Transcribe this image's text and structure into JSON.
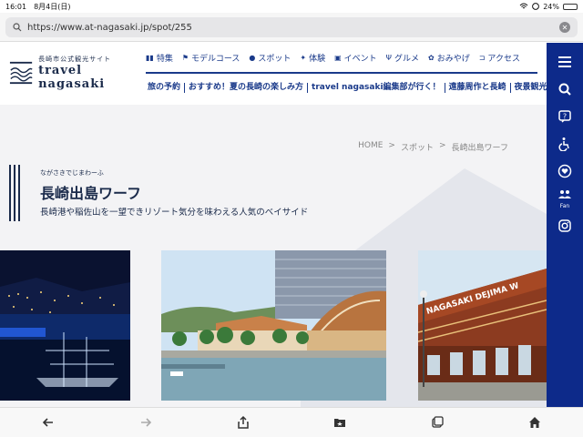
{
  "status": {
    "time": "16:01",
    "date": "8月4日(日)",
    "battery": "24%"
  },
  "browser": {
    "url": "https://www.at-nagasaki.jp/spot/255"
  },
  "logo": {
    "small": "長崎市公式観光サイト",
    "big": "travel nagasaki"
  },
  "nav_primary": [
    {
      "label": "特集",
      "icon": "book-icon"
    },
    {
      "label": "モデルコース",
      "icon": "flag-icon"
    },
    {
      "label": "スポット",
      "icon": "pin-icon"
    },
    {
      "label": "体験",
      "icon": "star-icon"
    },
    {
      "label": "イベント",
      "icon": "calendar-icon"
    },
    {
      "label": "グルメ",
      "icon": "fork-icon"
    },
    {
      "label": "おみやげ",
      "icon": "gift-icon"
    },
    {
      "label": "アクセス",
      "icon": "bus-icon"
    }
  ],
  "nav_secondary": [
    {
      "label": "旅の予約"
    },
    {
      "label": "おすすめ！夏の長崎の楽しみ方"
    },
    {
      "label": "travel nagasaki編集部が行く！"
    },
    {
      "label": "遠藤周作と長崎"
    },
    {
      "label": "夜景観光"
    }
  ],
  "sidebar": {
    "fan_label": "Fan"
  },
  "breadcrumb": {
    "home": "HOME",
    "sep1": ">",
    "spot": "スポット",
    "sep2": ">",
    "current": "長崎出島ワーフ"
  },
  "page": {
    "furigana": "ながさきでじまわーふ",
    "title": "長崎出島ワーフ",
    "subtitle": "長崎港や稲佐山を一望できリゾート気分を味わえる人気のベイサイド"
  },
  "photos": {
    "sign_text": "NAGASAKI DEJIMA W"
  },
  "colors": {
    "brand_navy": "#0d2a8a",
    "text_navy": "#1a2a4a"
  }
}
